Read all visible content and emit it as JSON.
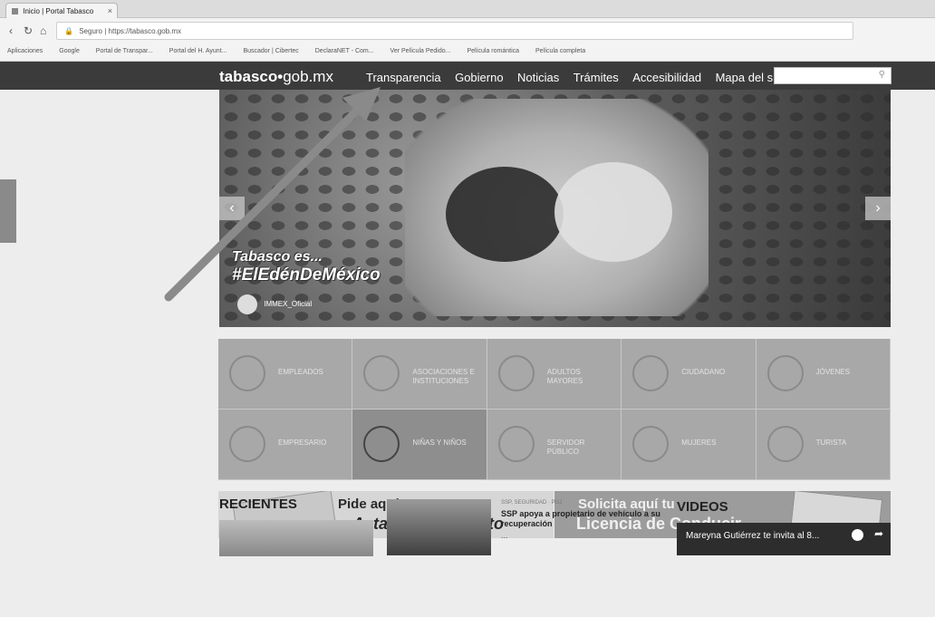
{
  "browser": {
    "tab_title": "Inicio | Portal Tabasco",
    "tab_close": "×",
    "url_secure": "Seguro",
    "url": "https://tabasco.gob.mx",
    "bookmarks": [
      "Aplicaciones",
      "Google",
      "Portal de Transpar...",
      "Portal del H. Ayunt...",
      "Buscador | Cibertec",
      "DeclaraNET - Com...",
      "Ver Película Pedido...",
      "Película romántica",
      "Película completa"
    ]
  },
  "site": {
    "logo_bold": "tabasco",
    "logo_dot": "•",
    "logo_rest": "gob.mx",
    "menu": [
      "Transparencia",
      "Gobierno",
      "Noticias",
      "Trámites",
      "Accesibilidad",
      "Mapa del sitio"
    ],
    "search_icon": "search-icon"
  },
  "hero": {
    "line1": "Tabasco es...",
    "line2": "#ElEdénDeMéxico",
    "credit": "IMMEX_Oficial",
    "prev": "‹",
    "next": "›"
  },
  "tiles": [
    {
      "label": "EMPLEADOS",
      "style": "mid"
    },
    {
      "label": "ASOCIACIONES E INSTITUCIONES",
      "style": "mid"
    },
    {
      "label": "ADULTOS MAYORES",
      "style": "mid"
    },
    {
      "label": "CIUDADANO",
      "style": "mid"
    },
    {
      "label": "JÓVENES",
      "style": "mid"
    },
    {
      "label": "EMPRESARIO",
      "style": "mid"
    },
    {
      "label": "NIÑAS Y NIÑOS",
      "style": "dark"
    },
    {
      "label": "SERVIDOR PÚBLICO",
      "style": "mid"
    },
    {
      "label": "MUJERES",
      "style": "mid"
    },
    {
      "label": "TURISTA",
      "style": "mid"
    }
  ],
  "banners": {
    "acta_line1": "Pide aquí tu",
    "acta_line2": "Acta de Nacimiento",
    "licencia_line1": "Solicita aquí tu",
    "licencia_line2": "Licencia de Conducir"
  },
  "news": {
    "recientes": "RECIENTES",
    "category": "SSP, SEGURIDAD · PGJ",
    "title": "SSP apoya a propietario de vehículo a su recuperación",
    "more": "..."
  },
  "videos": {
    "heading": "VIDEOS",
    "title": "Mareyna Gutiérrez te invita al 8..."
  }
}
